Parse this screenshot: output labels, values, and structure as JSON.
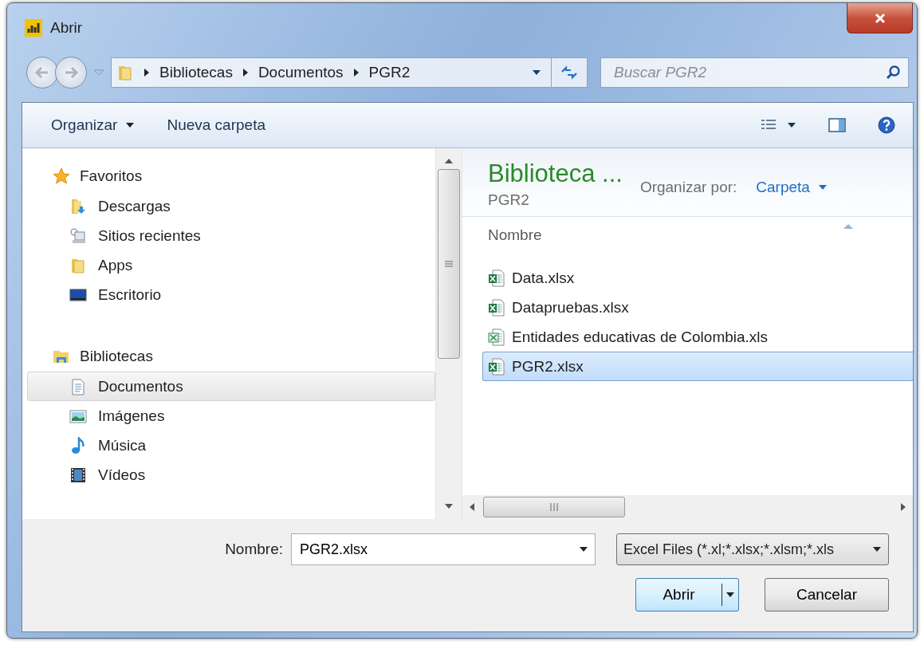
{
  "window": {
    "title": "Abrir"
  },
  "address_bar": {
    "breadcrumbs": [
      "Bibliotecas",
      "Documentos",
      "PGR2"
    ]
  },
  "search": {
    "placeholder": "Buscar PGR2"
  },
  "toolbar": {
    "items": [
      "Organizar",
      "Nueva carpeta"
    ]
  },
  "navigation": {
    "groups": [
      {
        "label": "Favoritos",
        "children": [
          {
            "label": "Descargas",
            "selected": false
          },
          {
            "label": "Sitios recientes",
            "selected": false
          },
          {
            "label": "Apps",
            "selected": false
          },
          {
            "label": "Escritorio",
            "selected": false
          }
        ]
      },
      {
        "label": "Bibliotecas",
        "children": [
          {
            "label": "Documentos",
            "selected": true
          },
          {
            "label": "Imágenes",
            "selected": false
          },
          {
            "label": "Música",
            "selected": false
          },
          {
            "label": "Vídeos",
            "selected": false
          }
        ]
      }
    ]
  },
  "library_header": {
    "title": "Biblioteca ...",
    "subtitle": "PGR2",
    "arrange_label": "Organizar por:",
    "arrange_value": "Carpeta"
  },
  "file_list": {
    "column": "Nombre",
    "files": [
      {
        "name": "Data.xlsx",
        "kind": "xlsx",
        "selected": false
      },
      {
        "name": "Datapruebas.xlsx",
        "kind": "xlsx",
        "selected": false
      },
      {
        "name": "Entidades educativas de Colombia.xls",
        "kind": "xls",
        "selected": false
      },
      {
        "name": "PGR2.xlsx",
        "kind": "xlsx",
        "selected": true
      }
    ]
  },
  "footer": {
    "filename_label": "Nombre:",
    "filename_value": "PGR2.xlsx",
    "filter_value": "Excel Files (*.xl;*.xlsx;*.xlsm;*.xls",
    "buttons": [
      {
        "label": "Abrir",
        "kind": "split"
      },
      {
        "label": "Cancelar",
        "kind": "plain"
      }
    ]
  }
}
